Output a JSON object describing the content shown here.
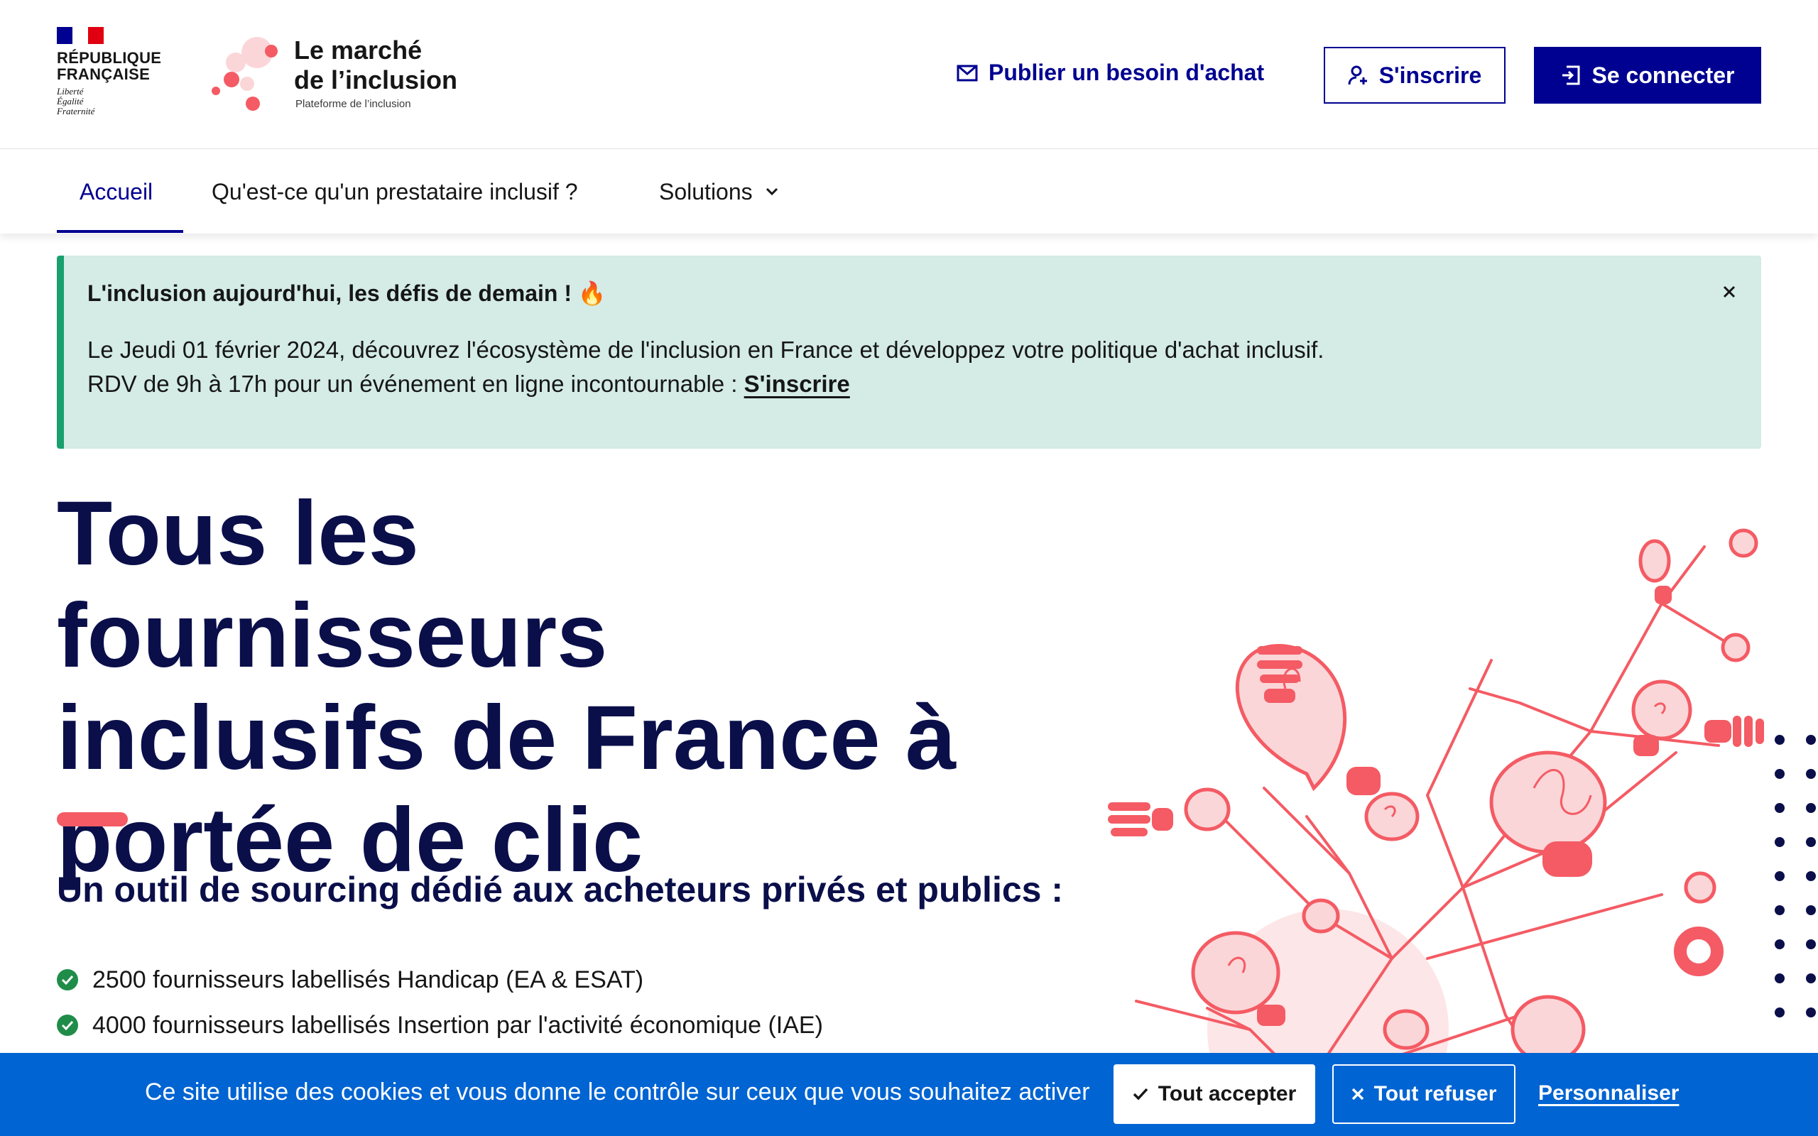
{
  "header": {
    "gov_logo": {
      "line1": "RÉPUBLIQUE",
      "line2": "FRANÇAISE",
      "motto1": "Liberté",
      "motto2": "Égalité",
      "motto3": "Fraternité"
    },
    "brand": {
      "title_line1": "Le marché",
      "title_line2": "de l’inclusion",
      "subtitle": "Plateforme de l’inclusion"
    },
    "publish_link": "Publier un besoin d'achat",
    "signup_button": "S'inscrire",
    "login_button": "Se connecter"
  },
  "nav": {
    "items": [
      {
        "label": "Accueil",
        "active": true
      },
      {
        "label": "Qu'est-ce qu'un prestataire inclusif ?"
      },
      {
        "label": "Solutions",
        "dropdown": true
      }
    ]
  },
  "notice": {
    "title": "L'inclusion aujourd'hui, les défis de demain ! 🔥",
    "line1": "Le Jeudi 01 février 2024, découvrez l'écosystème de l'inclusion en France et développez votre politique d'achat inclusif.",
    "line2": "RDV de 9h à 17h pour un événement en ligne incontournable : ",
    "link": "S'inscrire"
  },
  "hero": {
    "title_line1": "Tous les fournisseurs",
    "title_line2": "inclusifs de France à",
    "title_line3": "portée de clic",
    "subtitle": "Un outil de sourcing dédié aux acheteurs privés et publics :",
    "bullets": [
      "2500 fournisseurs labellisés Handicap (EA & ESAT)",
      "4000 fournisseurs labellisés Insertion par l'activité économique (IAE)"
    ]
  },
  "cookie": {
    "text": "Ce site utilise des cookies et vous donne le contrôle sur ceux que vous souhaitez activer",
    "accept": "Tout accepter",
    "refuse": "Tout refuser",
    "customize": "Personnaliser"
  },
  "colors": {
    "primary": "#000091",
    "accent": "#f45b64",
    "notice_bg": "#d4ebe6",
    "notice_border": "#18a06f",
    "cookie_bg": "#0064d2"
  }
}
